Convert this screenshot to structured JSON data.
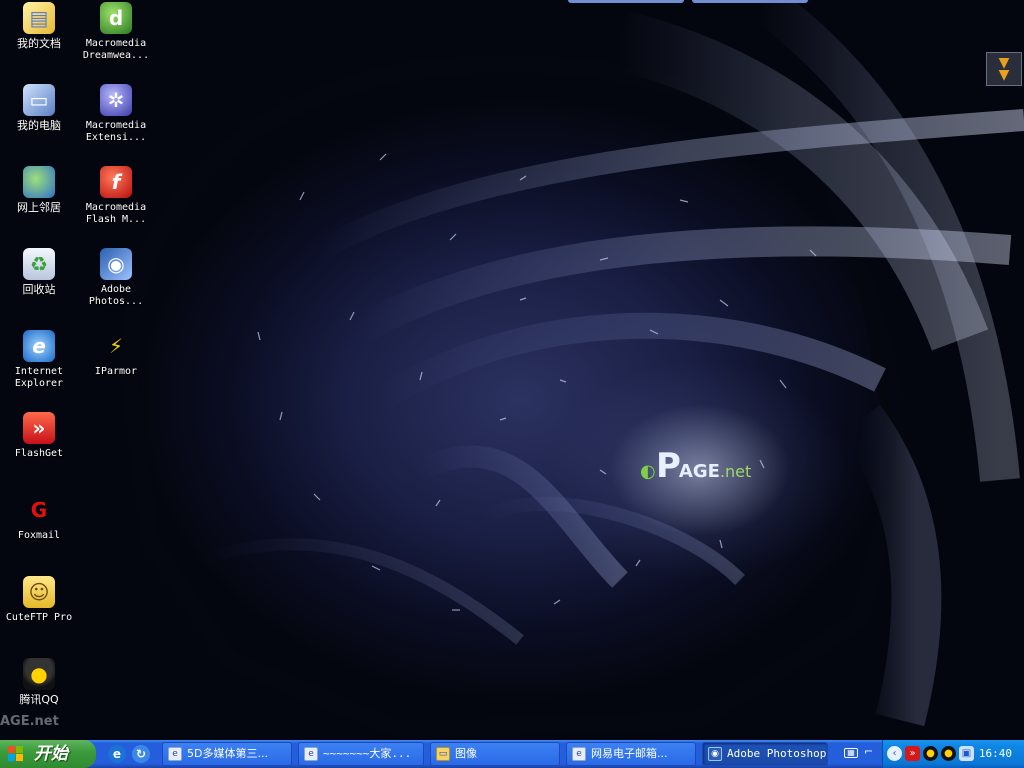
{
  "desktop": {
    "icons_col1": [
      {
        "label": "我的文档",
        "icon": "my-documents-icon"
      },
      {
        "label": "我的电脑",
        "icon": "my-computer-icon"
      },
      {
        "label": "网上邻居",
        "icon": "network-places-icon"
      },
      {
        "label": "回收站",
        "icon": "recycle-bin-icon"
      },
      {
        "label": "Internet\nExplorer",
        "icon": "internet-explorer-icon"
      },
      {
        "label": "FlashGet",
        "icon": "flashget-icon"
      },
      {
        "label": "Foxmail",
        "icon": "foxmail-icon"
      },
      {
        "label": "CuteFTP Pro",
        "icon": "cuteftp-icon"
      },
      {
        "label": "腾讯QQ",
        "icon": "qq-icon"
      }
    ],
    "icons_col2": [
      {
        "label": "Macromedia\nDreamwea...",
        "icon": "dreamweaver-icon"
      },
      {
        "label": "Macromedia\nExtensi...",
        "icon": "extension-manager-icon"
      },
      {
        "label": "Macromedia\nFlash M...",
        "icon": "flash-icon"
      },
      {
        "label": "Adobe\nPhotos...",
        "icon": "photoshop-icon"
      },
      {
        "label": "IParmor",
        "icon": "iparmor-icon"
      }
    ],
    "wallpaper_logo": {
      "p": "P",
      "rest": "AGE",
      "net": ".net"
    },
    "mini_logo": "AGE.net"
  },
  "taskbar": {
    "start_label": "开始",
    "quick_launch": [
      "internet-explorer-icon",
      "ie-refresh-icon"
    ],
    "tasks": [
      {
        "label": "5D多媒体第三...",
        "icon": "ie-window-icon",
        "mono": false,
        "active": false
      },
      {
        "label": "~~~~~~~大家...",
        "icon": "ie-window-icon",
        "mono": true,
        "active": false
      },
      {
        "label": "图像",
        "icon": "folder-icon",
        "mono": false,
        "active": false
      },
      {
        "label": "网易电子邮箱...",
        "icon": "ie-window-icon",
        "mono": false,
        "active": false
      },
      {
        "label": "Adobe Photoshop",
        "icon": "photoshop-icon",
        "mono": true,
        "active": true
      }
    ],
    "tray": {
      "icons": [
        "keyboard-icon",
        "ime-icon",
        "expand-tray-icon",
        "flashget-tray-icon",
        "qq-tray-icon",
        "qq-tray-icon-2",
        "network-icon"
      ],
      "clock": "16:40"
    }
  },
  "colors": {
    "taskbar": "#245edb",
    "start_button": "#3c9c3c",
    "tray": "#0e87e6"
  }
}
